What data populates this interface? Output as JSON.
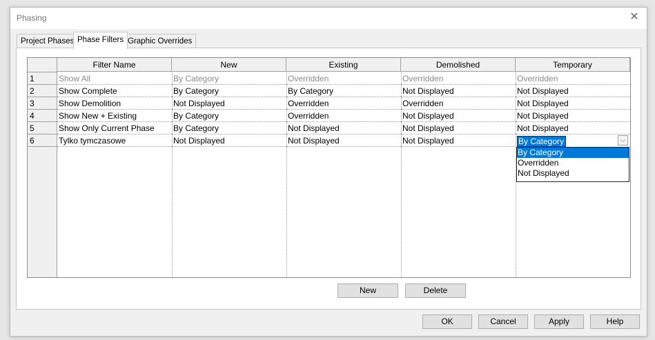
{
  "window": {
    "title": "Phasing",
    "close_glyph": "✕"
  },
  "tabs": [
    {
      "label": "Project Phases",
      "active": false
    },
    {
      "label": "Phase Filters",
      "active": true
    },
    {
      "label": "Graphic Overrides",
      "active": false
    }
  ],
  "table": {
    "columns": [
      "Filter Name",
      "New",
      "Existing",
      "Demolished",
      "Temporary"
    ],
    "rows": [
      {
        "num": "1",
        "cells": [
          "Show All",
          "By Category",
          "Overridden",
          "Overridden",
          "Overridden"
        ],
        "disabled": true
      },
      {
        "num": "2",
        "cells": [
          "Show Complete",
          "By Category",
          "By Category",
          "Not Displayed",
          "Not Displayed"
        ]
      },
      {
        "num": "3",
        "cells": [
          "Show Demolition",
          "Not Displayed",
          "Overridden",
          "Overridden",
          "Not Displayed"
        ]
      },
      {
        "num": "4",
        "cells": [
          "Show New + Existing",
          "By Category",
          "Overridden",
          "Not Displayed",
          "Not Displayed"
        ]
      },
      {
        "num": "5",
        "cells": [
          "Show Only Current Phase",
          "By Category",
          "Not Displayed",
          "Not Displayed",
          "Not Displayed"
        ]
      },
      {
        "num": "6",
        "cells": [
          "Tylko tymczasowe",
          "Not Displayed",
          "Not Displayed",
          "Not Displayed",
          "By Category"
        ]
      }
    ]
  },
  "dropdown": {
    "selected": "By Category",
    "options": [
      "By Category",
      "Overridden",
      "Not Displayed"
    ],
    "arrow_icon": "chevron-down-icon"
  },
  "panel_buttons": {
    "new": "New",
    "delete": "Delete"
  },
  "footer_buttons": {
    "ok": "OK",
    "cancel": "Cancel",
    "apply": "Apply",
    "help": "Help"
  },
  "colors": {
    "selection": "#0078d7",
    "dialog_bg": "#f0f0f0"
  }
}
